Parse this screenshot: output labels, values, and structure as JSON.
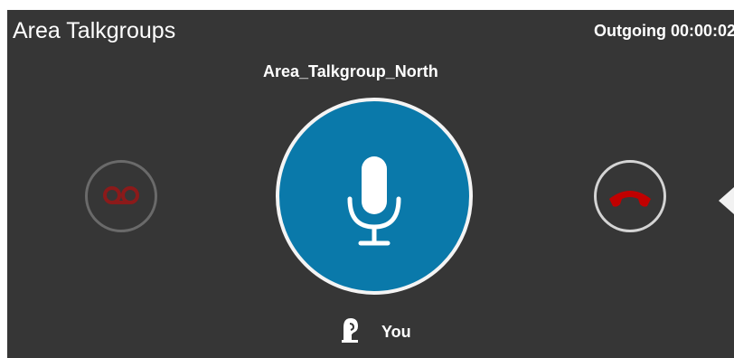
{
  "header": {
    "title": "Area Talkgroups",
    "call_status": "Outgoing 00:00:02"
  },
  "call": {
    "group_name": "Area_Talkgroup_North",
    "speaker": "You"
  },
  "icons": {
    "voicemail": "voicemail-icon",
    "microphone": "microphone-icon",
    "hangup": "hang-up-phone-icon",
    "expand": "triangle-left-icon",
    "speaker": "ear-head-icon"
  },
  "colors": {
    "panel_background": "#363636",
    "ptt_accent": "#0a79aa",
    "ptt_ring": "#f4f4f4",
    "voicemail_icon": "#8b1a1a",
    "hangup_icon": "#c00000",
    "text": "#ffffff"
  }
}
